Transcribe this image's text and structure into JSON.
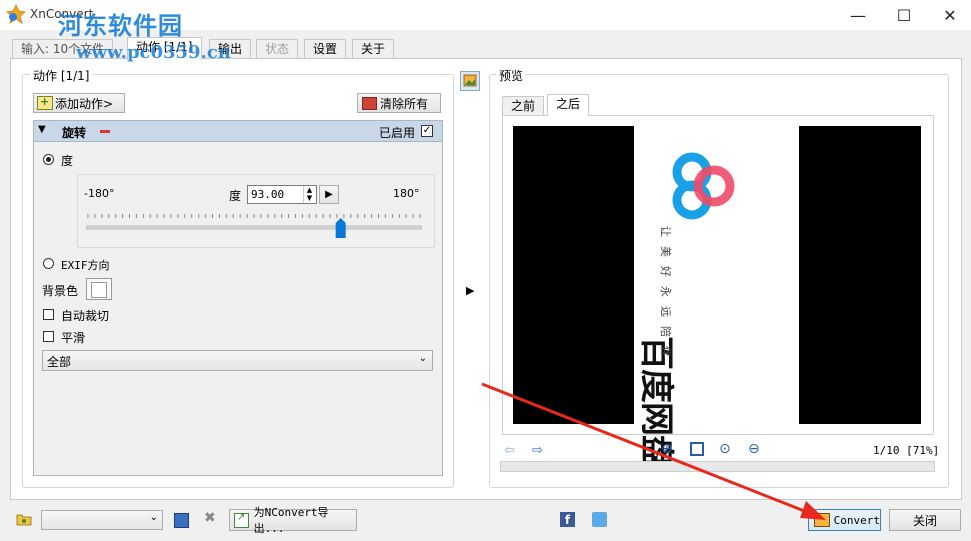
{
  "window": {
    "title": "XnConvert",
    "watermark": "河东软件园",
    "watermark_url": "www.pc0359.cn",
    "minimize": "—",
    "maximize": "☐",
    "close": "✕"
  },
  "tabs": [
    {
      "label": "输入: 10个文件",
      "state": "normal"
    },
    {
      "label": "动作 [1/1]",
      "state": "active"
    },
    {
      "label": "输出",
      "state": "normal"
    },
    {
      "label": "状态",
      "state": "disabled"
    },
    {
      "label": "设置",
      "state": "normal"
    },
    {
      "label": "关于",
      "state": "normal"
    }
  ],
  "actions": {
    "group_title": "动作 [1/1]",
    "add_button": "添加动作>",
    "clear_button": "清除所有",
    "rotate": {
      "title": "旋转",
      "enabled_label": "已启用",
      "enabled": true,
      "degree_label": "度",
      "min_label": "-180°",
      "max_label": "180°",
      "value_label": "度",
      "value": "93.00",
      "slider_fraction": 0.758,
      "exif_label": "EXIF方向",
      "bg_color_label": "背景色",
      "auto_crop_label": "自动裁切",
      "smooth_label": "平滑",
      "scope_select": "全部"
    }
  },
  "preview": {
    "group_title": "预览",
    "tab_before": "之前",
    "tab_after": "之后",
    "image_brand": "百度网盘",
    "image_slogan": "让美好永远陪伴",
    "page_info": "1/10 [71%]"
  },
  "bottom": {
    "export_button": "为NConvert导出...",
    "convert_button": "Convert",
    "close_button": "关闭"
  },
  "colors": {
    "accent": "#1a7fd6",
    "arrow": "#e8281e",
    "action_header": "#c9d8e8"
  }
}
